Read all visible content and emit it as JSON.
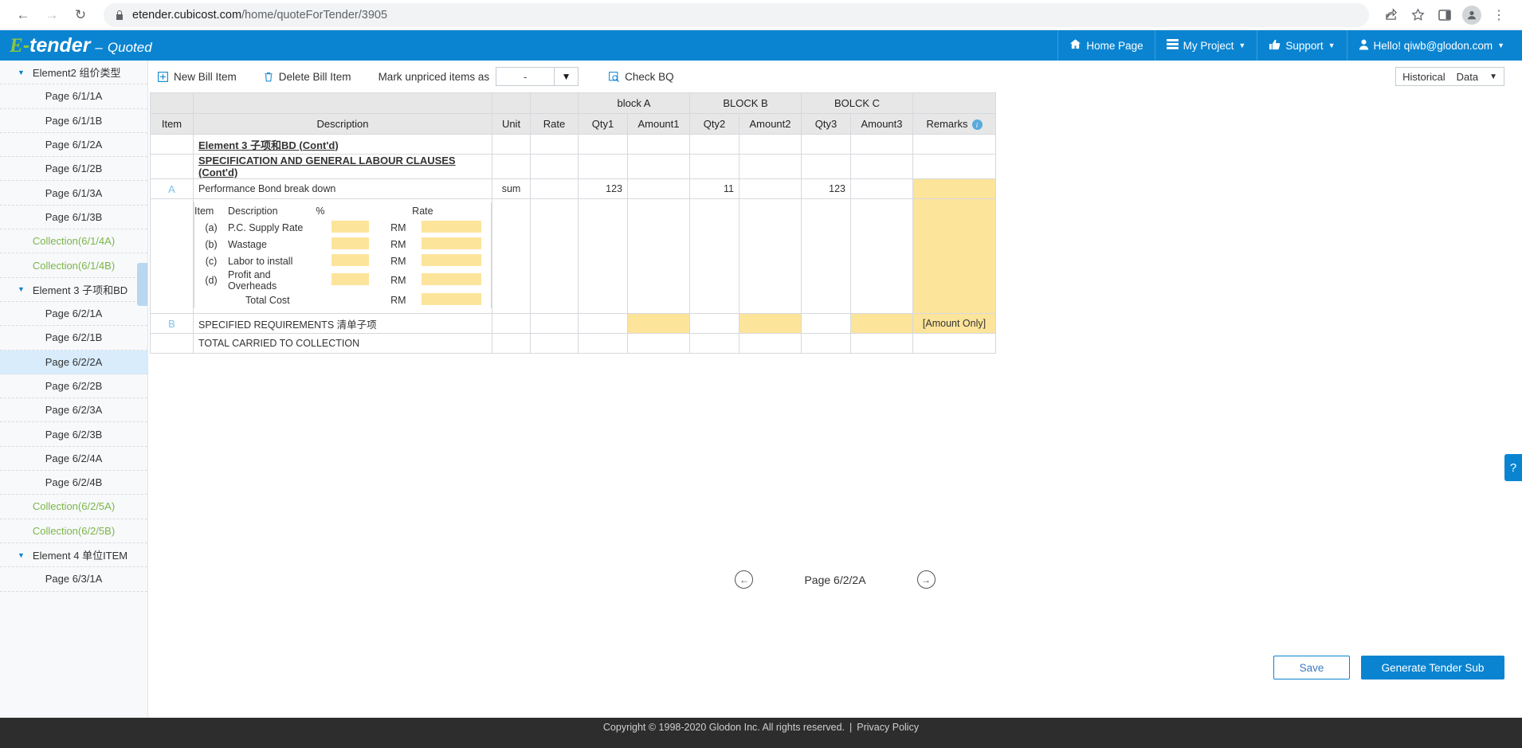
{
  "browser": {
    "back_icon": "back-arrow-icon",
    "forward_icon": "forward-arrow-icon",
    "reload_icon": "reload-icon",
    "lock_icon": "lock-icon",
    "url_main": "etender.cubicost.com",
    "url_path": "/home/quoteForTender/3905",
    "share_icon": "share-icon",
    "bookmark_icon": "star-icon",
    "sidepanel_icon": "side-panel-icon",
    "profile_icon": "profile-avatar-icon",
    "menu_icon": "three-dot-menu-icon"
  },
  "app_header": {
    "brand_e": "E",
    "brand_dash": "-",
    "brand_tender": "tender",
    "brand_sep": "–",
    "brand_status": "Quoted",
    "nav": [
      {
        "label": "Home Page",
        "icon": "home-icon",
        "caret": false
      },
      {
        "label": "My Project",
        "icon": "project-list-icon",
        "caret": true
      },
      {
        "label": "Support",
        "icon": "thumbs-up-icon",
        "caret": true
      },
      {
        "label": "Hello! qiwb@glodon.com",
        "icon": "user-icon",
        "caret": true
      }
    ]
  },
  "sidebar": {
    "items": [
      {
        "label": "Element2 组价类型",
        "type": "group",
        "expanded": true,
        "active": false
      },
      {
        "label": "Page 6/1/1A",
        "type": "page",
        "active": false
      },
      {
        "label": "Page 6/1/1B",
        "type": "page",
        "active": false
      },
      {
        "label": "Page 6/1/2A",
        "type": "page",
        "active": false
      },
      {
        "label": "Page 6/1/2B",
        "type": "page",
        "active": false
      },
      {
        "label": "Page 6/1/3A",
        "type": "page",
        "active": false
      },
      {
        "label": "Page 6/1/3B",
        "type": "page",
        "active": false
      },
      {
        "label": "Collection(6/1/4A)",
        "type": "collection",
        "active": false
      },
      {
        "label": "Collection(6/1/4B)",
        "type": "collection",
        "active": false
      },
      {
        "label": "Element 3 子项和BD",
        "type": "group",
        "expanded": true,
        "active": false
      },
      {
        "label": "Page 6/2/1A",
        "type": "page",
        "active": false
      },
      {
        "label": "Page 6/2/1B",
        "type": "page",
        "active": false
      },
      {
        "label": "Page 6/2/2A",
        "type": "page",
        "active": true
      },
      {
        "label": "Page 6/2/2B",
        "type": "page",
        "active": false
      },
      {
        "label": "Page 6/2/3A",
        "type": "page",
        "active": false
      },
      {
        "label": "Page 6/2/3B",
        "type": "page",
        "active": false
      },
      {
        "label": "Page 6/2/4A",
        "type": "page",
        "active": false
      },
      {
        "label": "Page 6/2/4B",
        "type": "page",
        "active": false
      },
      {
        "label": "Collection(6/2/5A)",
        "type": "collection",
        "active": false
      },
      {
        "label": "Collection(6/2/5B)",
        "type": "collection",
        "active": false
      },
      {
        "label": "Element 4 单位ITEM",
        "type": "group",
        "expanded": true,
        "active": false
      },
      {
        "label": "Page 6/3/1A",
        "type": "page",
        "active": false
      }
    ]
  },
  "toolbar": {
    "new_bill_item": "New Bill Item",
    "new_bill_item_icon": "plus-box-icon",
    "delete_bill_item": "Delete Bill Item",
    "delete_bill_item_icon": "trash-icon",
    "mark_unpriced_label": "Mark unpriced items as",
    "mark_unpriced_value": "-",
    "dropdown_icon": "chevron-down-icon",
    "check_bq": "Check BQ",
    "check_bq_icon": "check-bq-icon",
    "historical_data_1": "Historical",
    "historical_data_2": "Data",
    "historical_caret_icon": "chevron-down-icon"
  },
  "table": {
    "group_headers": [
      {
        "label": "",
        "span": 1
      },
      {
        "label": "",
        "span": 1
      },
      {
        "label": "",
        "span": 1
      },
      {
        "label": "",
        "span": 1
      },
      {
        "label": "block A",
        "span": 2
      },
      {
        "label": "BLOCK B",
        "span": 2
      },
      {
        "label": "BOLCK C",
        "span": 2
      },
      {
        "label": "",
        "span": 1
      }
    ],
    "columns": [
      "Item",
      "Description",
      "Unit",
      "Rate",
      "Qty1",
      "Amount1",
      "Qty2",
      "Amount2",
      "Qty3",
      "Amount3",
      "Remarks"
    ],
    "remarks_info_icon": "info-icon",
    "rows": [
      {
        "kind": "title",
        "item": "",
        "description": "Element 3 子项和BD (Cont'd)",
        "unit": "",
        "rate": "",
        "qty1": "",
        "amount1": "",
        "qty2": "",
        "amount2": "",
        "qty3": "",
        "amount3": "",
        "remarks": ""
      },
      {
        "kind": "title",
        "item": "",
        "description": "SPECIFICATION AND GENERAL LABOUR CLAUSES (Cont'd)",
        "unit": "",
        "rate": "",
        "qty1": "",
        "amount1": "",
        "qty2": "",
        "amount2": "",
        "qty3": "",
        "amount3": "",
        "remarks": ""
      },
      {
        "kind": "item",
        "item": "A",
        "description": "Performance Bond break down",
        "unit": "sum",
        "rate": "",
        "qty1": "123",
        "amount1": "",
        "qty2": "11",
        "amount2": "",
        "qty3": "123",
        "amount3": "",
        "remarks": ""
      },
      {
        "kind": "item",
        "item": "B",
        "description": "SPECIFIED REQUIREMENTS 清单子项",
        "unit": "",
        "rate": "",
        "qty1": "",
        "amount1": "",
        "qty2": "",
        "amount2": "",
        "qty3": "",
        "amount3": "",
        "remarks": "[Amount Only]"
      },
      {
        "kind": "total",
        "item": "",
        "description": "TOTAL CARRIED TO COLLECTION",
        "unit": "",
        "rate": "",
        "qty1": "",
        "amount1": "",
        "qty2": "",
        "amount2": "",
        "qty3": "",
        "amount3": "",
        "remarks": ""
      }
    ],
    "breakdown": {
      "headers": [
        "Item",
        "Description",
        "%",
        "",
        "Rate"
      ],
      "currency": "RM",
      "rows": [
        {
          "item": "(a)",
          "description": "P.C. Supply Rate",
          "pct": "",
          "rate": ""
        },
        {
          "item": "(b)",
          "description": "Wastage",
          "pct": "",
          "rate": ""
        },
        {
          "item": "(c)",
          "description": "Labor to install",
          "pct": "",
          "rate": ""
        },
        {
          "item": "(d)",
          "description": "Profit and Overheads",
          "pct": "",
          "rate": ""
        }
      ],
      "total_label": "Total Cost",
      "total_currency": "RM",
      "total_value": ""
    }
  },
  "pager": {
    "prev_icon": "arrow-left-circle-icon",
    "next_icon": "arrow-right-circle-icon",
    "current_page": "Page 6/2/2A"
  },
  "actions": {
    "save": "Save",
    "generate": "Generate Tender Sub"
  },
  "help": {
    "icon": "question-mark-icon",
    "label": "?"
  },
  "footer": {
    "copyright": "Copyright © 1998-2020 Glodon Inc. All rights reserved.",
    "divider": "|",
    "privacy": "Privacy Policy"
  },
  "colors": {
    "brand_blue": "#0a84d1",
    "brand_green": "#8bc63f",
    "highlight_yellow": "#fde49b",
    "active_row": "#d8ecfb"
  }
}
